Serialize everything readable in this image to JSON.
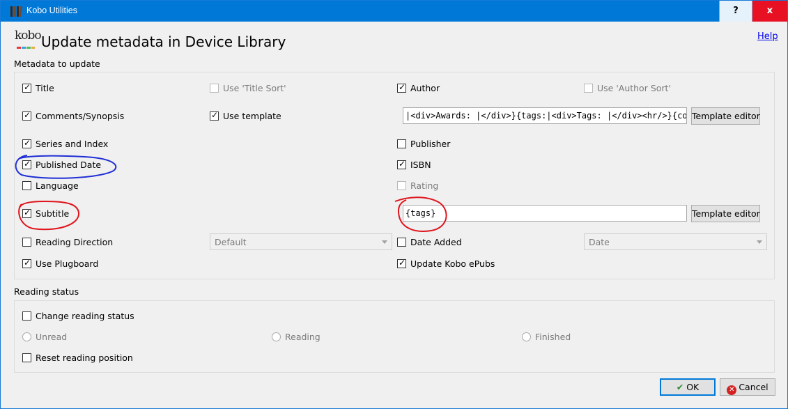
{
  "window": {
    "title": "Kobo Utilities",
    "help_button": "?",
    "close_button": "x"
  },
  "header": {
    "logo_text": "kobo",
    "title": "Update metadata in Device Library",
    "help_link": "Help"
  },
  "metadata": {
    "section_label": "Metadata to update",
    "title": {
      "label": "Title",
      "checked": true
    },
    "use_title_sort": {
      "label": "Use 'Title Sort'",
      "checked": false,
      "disabled": true
    },
    "author": {
      "label": "Author",
      "checked": true
    },
    "use_author_sort": {
      "label": "Use 'Author Sort'",
      "checked": false,
      "disabled": true
    },
    "comments": {
      "label": "Comments/Synopsis",
      "checked": true
    },
    "use_template": {
      "label": "Use template",
      "checked": true
    },
    "comments_template": "|<div>Awards: |</div>}{tags:|<div>Tags: |</div><hr/>}{comments}",
    "template_editor_1": "Template editor",
    "series": {
      "label": "Series and Index",
      "checked": true
    },
    "publisher": {
      "label": "Publisher",
      "checked": false
    },
    "published_date": {
      "label": "Published Date",
      "checked": true
    },
    "isbn": {
      "label": "ISBN",
      "checked": true
    },
    "language": {
      "label": "Language",
      "checked": false
    },
    "rating": {
      "label": "Rating",
      "checked": false,
      "disabled": true
    },
    "subtitle": {
      "label": "Subtitle",
      "checked": true
    },
    "subtitle_template": "{tags}",
    "template_editor_2": "Template editor",
    "reading_direction": {
      "label": "Reading Direction",
      "checked": false
    },
    "reading_direction_value": "Default",
    "date_added": {
      "label": "Date Added",
      "checked": false
    },
    "date_added_value": "Date",
    "use_plugboard": {
      "label": "Use Plugboard",
      "checked": true
    },
    "update_kobo_epubs": {
      "label": "Update Kobo ePubs",
      "checked": true
    }
  },
  "reading_status": {
    "section_label": "Reading status",
    "change": {
      "label": "Change reading status",
      "checked": false
    },
    "unread": "Unread",
    "reading": "Reading",
    "finished": "Finished",
    "reset_position": {
      "label": "Reset reading position",
      "checked": false
    }
  },
  "footer": {
    "ok": "OK",
    "cancel": "Cancel"
  },
  "colors": {
    "titlebar": "#0078d7",
    "close": "#e81123",
    "annotation_blue": "#1f2fd6",
    "annotation_red": "#e0141c"
  }
}
